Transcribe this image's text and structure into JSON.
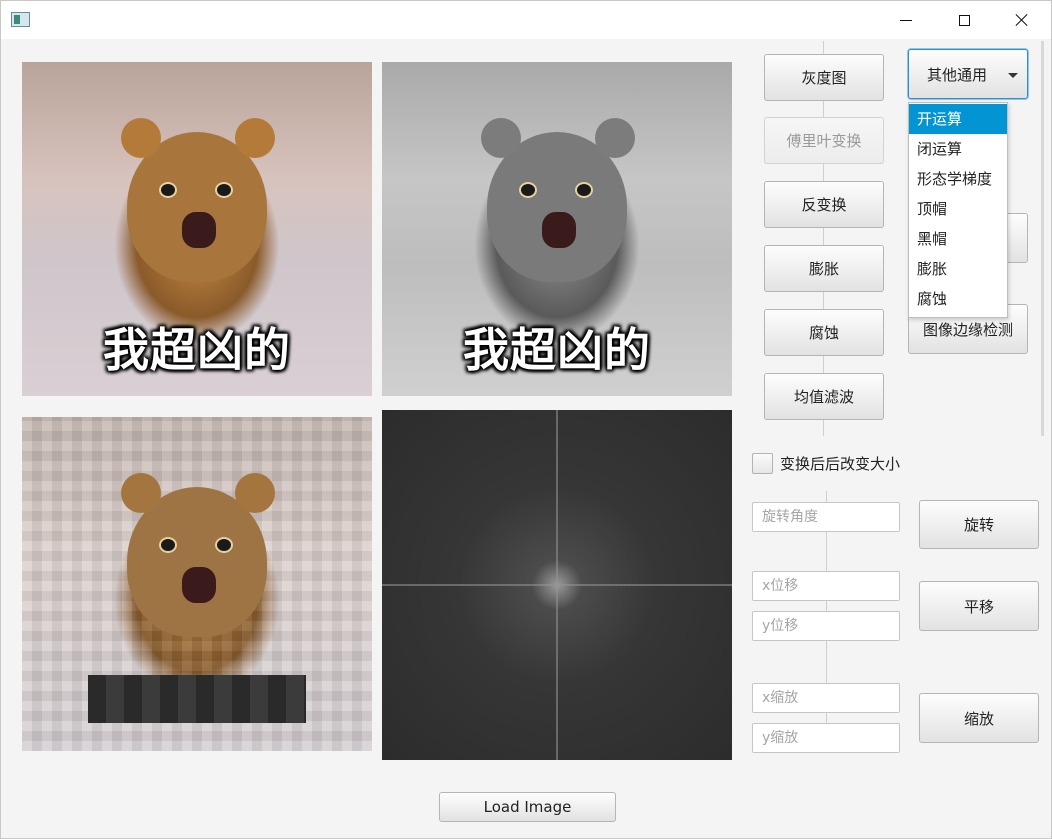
{
  "window": {
    "title": "",
    "controls": {
      "minimize": "minimize",
      "maximize": "maximize",
      "close": "close"
    }
  },
  "images": {
    "original_caption": "我超凶的",
    "grayscale_caption": "我超凶的",
    "pixelated_caption": "",
    "fourier_caption": ""
  },
  "toolbar": {
    "grayscale": "灰度图",
    "fourier": "傅里叶变换",
    "fourier_disabled": true,
    "inverse": "反变换",
    "dilate": "膨胀",
    "erode": "腐蚀",
    "mean_filter": "均值滤波",
    "combo_selected": "其他通用",
    "edge_detect": "图像边缘检测"
  },
  "combo_options": [
    "开运算",
    "闭运算",
    "形态学梯度",
    "顶帽",
    "黑帽",
    "膨胀",
    "腐蚀"
  ],
  "combo_highlighted_index": 0,
  "transform": {
    "resize_checkbox_label": "变换后后改变大小",
    "resize_checked": false,
    "rotate_placeholder": "旋转角度",
    "rotate_button": "旋转",
    "x_shift_placeholder": "x位移",
    "y_shift_placeholder": "y位移",
    "translate_button": "平移",
    "x_scale_placeholder": "x缩放",
    "y_scale_placeholder": "y缩放",
    "scale_button": "缩放"
  },
  "footer": {
    "load_button": "Load Image"
  }
}
